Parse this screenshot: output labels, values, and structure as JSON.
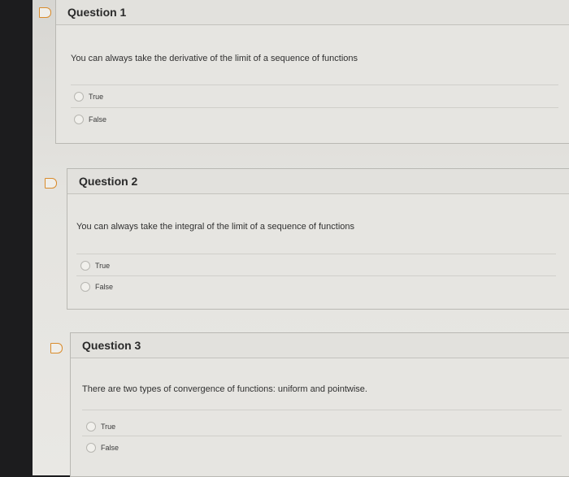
{
  "questions": [
    {
      "title": "Question 1",
      "text": "You can always take the derivative of the limit of a sequence of functions",
      "options": [
        "True",
        "False"
      ]
    },
    {
      "title": "Question 2",
      "text": "You can always take the integral of the limit of a sequence of functions",
      "options": [
        "True",
        "False"
      ]
    },
    {
      "title": "Question 3",
      "text": "There are two types of convergence of functions: uniform and pointwise.",
      "options": [
        "True",
        "False"
      ]
    }
  ],
  "colors": {
    "flag": "#d98b2b",
    "card_border": "#b9b8b3",
    "background": "#1c1c1e"
  },
  "icons": [
    "flag-icon",
    "radio-button-icon"
  ]
}
